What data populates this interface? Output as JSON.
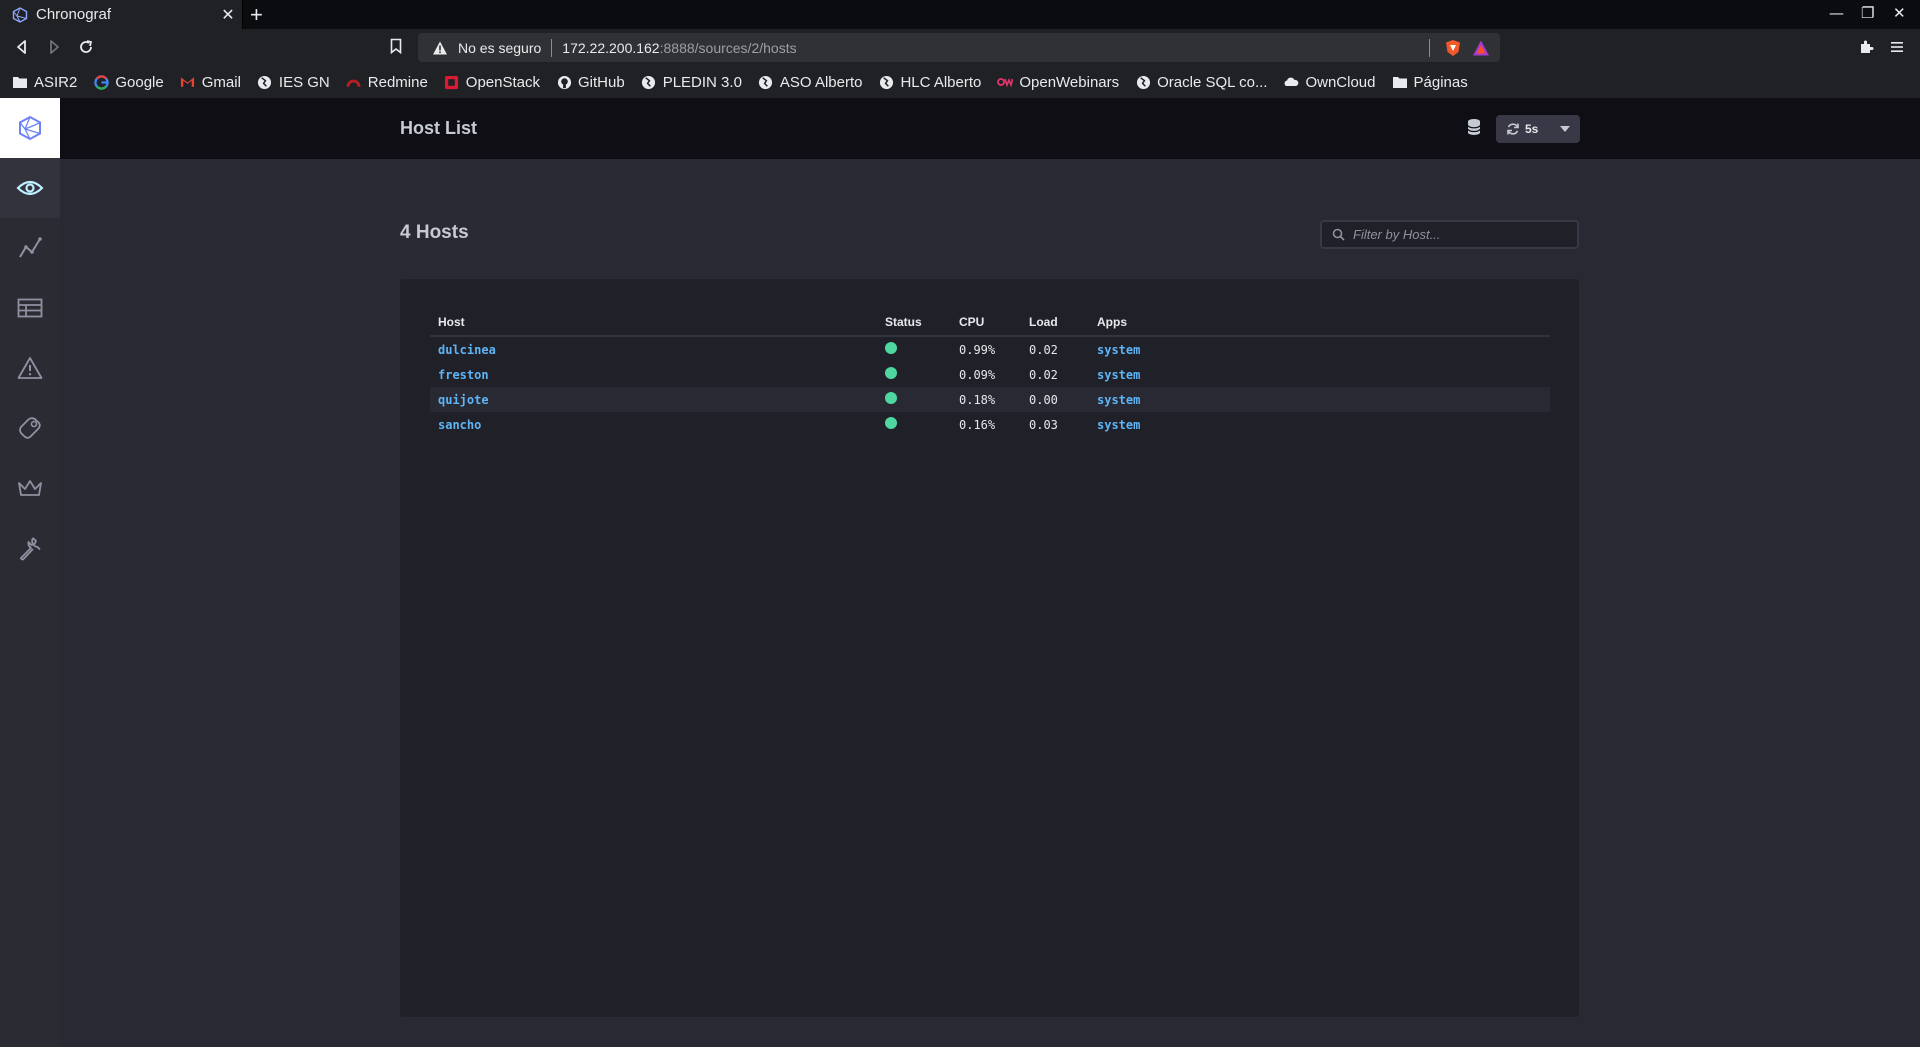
{
  "browser": {
    "tab_title": "Chronograf",
    "address": {
      "security_label": "No es seguro",
      "host": "172.22.200.162",
      "path": ":8888/sources/2/hosts"
    },
    "bookmarks": [
      {
        "label": "ASIR2",
        "icon": "folder-icon"
      },
      {
        "label": "Google",
        "icon": "google-icon"
      },
      {
        "label": "Gmail",
        "icon": "gmail-icon"
      },
      {
        "label": "IES GN",
        "icon": "globe-icon"
      },
      {
        "label": "Redmine",
        "icon": "redmine-icon"
      },
      {
        "label": "OpenStack",
        "icon": "openstack-icon"
      },
      {
        "label": "GitHub",
        "icon": "github-icon"
      },
      {
        "label": "PLEDIN 3.0",
        "icon": "globe-icon"
      },
      {
        "label": "ASO Alberto",
        "icon": "globe-icon"
      },
      {
        "label": "HLC Alberto",
        "icon": "globe-icon"
      },
      {
        "label": "OpenWebinars",
        "icon": "openwebinars-icon"
      },
      {
        "label": "Oracle SQL co...",
        "icon": "globe-icon"
      },
      {
        "label": "OwnCloud",
        "icon": "cloud-icon"
      },
      {
        "label": "Páginas",
        "icon": "folder-icon"
      }
    ]
  },
  "header": {
    "title": "Host List",
    "refresh_label": "5s"
  },
  "main": {
    "count_label": "4 Hosts",
    "filter_placeholder": "Filter by Host..."
  },
  "table": {
    "columns": [
      "Host",
      "Status",
      "CPU",
      "Load",
      "Apps"
    ],
    "rows": [
      {
        "host": "dulcinea",
        "status": "online",
        "cpu": "0.99%",
        "load": "0.02",
        "apps": "system"
      },
      {
        "host": "freston",
        "status": "online",
        "cpu": "0.09%",
        "load": "0.02",
        "apps": "system"
      },
      {
        "host": "quijote",
        "status": "online",
        "cpu": "0.18%",
        "load": "0.00",
        "apps": "system"
      },
      {
        "host": "sancho",
        "status": "online",
        "cpu": "0.16%",
        "load": "0.03",
        "apps": "system"
      }
    ]
  },
  "colors": {
    "accent_link": "#5eb4f5",
    "status_online": "#4ed8a0",
    "sidebar_active_icon": "#bef0ff"
  }
}
